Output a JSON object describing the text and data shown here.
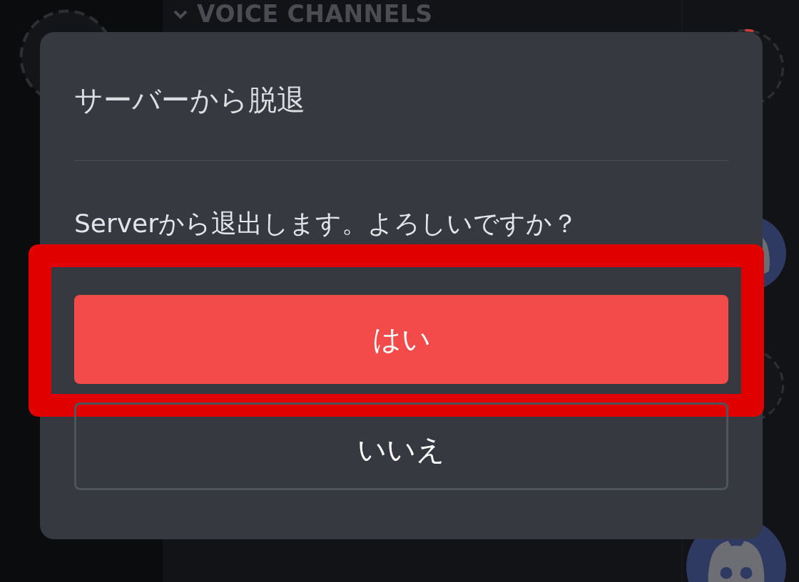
{
  "channel_list": {
    "section_header": "VOICE CHANNELS"
  },
  "dialog": {
    "title": "サーバーから脱退",
    "message": "Serverから退出します。よろしいですか？",
    "buttons": [
      {
        "label": "はい",
        "kind": "danger",
        "highlighted": true
      },
      {
        "label": "いいえ",
        "kind": "outline",
        "highlighted": false
      }
    ]
  }
}
